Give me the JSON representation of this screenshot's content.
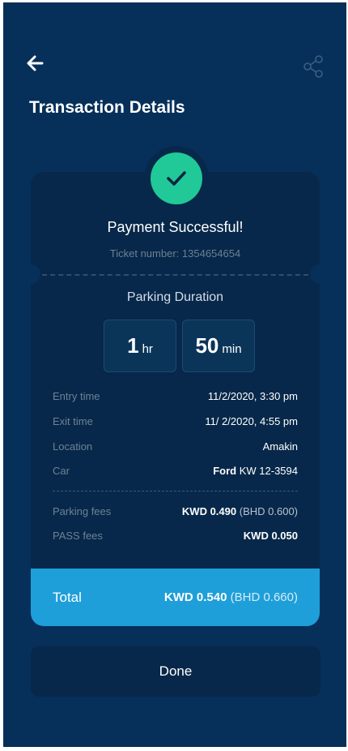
{
  "header": {
    "title": "Transaction Details"
  },
  "card": {
    "status_title": "Payment Successful!",
    "ticket_label": "Ticket number:",
    "ticket_number": "1354654654",
    "duration_title": "Parking Duration",
    "duration": {
      "hours": "1",
      "hours_unit": "hr",
      "minutes": "50",
      "minutes_unit": "min"
    },
    "details": [
      {
        "label": "Entry time",
        "value": "11/2/2020, 3:30 pm"
      },
      {
        "label": "Exit time",
        "value": "11/ 2/2020, 4:55 pm"
      },
      {
        "label": "Location",
        "value": "Amakin"
      },
      {
        "label": "Car",
        "value_bold": "Ford",
        "value": "KW 12-3594"
      }
    ],
    "fees": [
      {
        "label": "Parking fees",
        "value_bold": "KWD 0.490",
        "value": "(BHD 0.600)"
      },
      {
        "label": "PASS fees",
        "value_bold": "KWD 0.050",
        "value": ""
      }
    ],
    "total": {
      "label": "Total",
      "value_bold": "KWD 0.540",
      "value": "(BHD 0.660)"
    }
  },
  "actions": {
    "done_label": "Done"
  },
  "icons": {
    "back": "arrow-left-icon",
    "share": "share-icon",
    "success": "check-icon"
  },
  "colors": {
    "background": "#06305a",
    "card": "#07284a",
    "success": "#20c997",
    "total_bar": "#1e9fd9"
  }
}
